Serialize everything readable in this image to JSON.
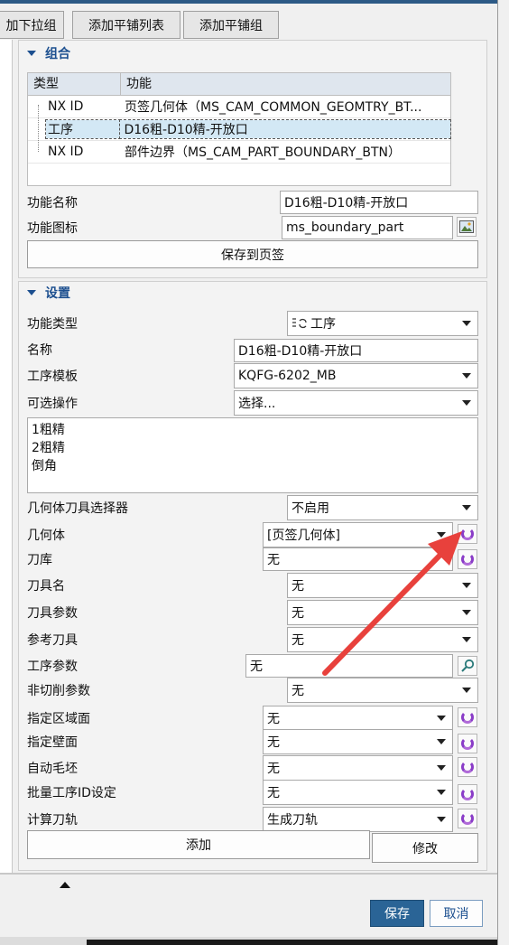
{
  "tabs": [
    "加下拉组",
    "添加平铺列表",
    "添加平铺组"
  ],
  "group_section": {
    "title": "组合",
    "columns": [
      "类型",
      "功能"
    ],
    "rows": [
      {
        "type": "NX ID",
        "function": "页签几何体（MS_CAM_COMMON_GEOMTRY_BT..."
      },
      {
        "type": "工序",
        "function": "D16粗-D10精-开放口"
      },
      {
        "type": "NX ID",
        "function": "部件边界（MS_CAM_PART_BOUNDARY_BTN）"
      }
    ],
    "function_name_label": "功能名称",
    "function_name_value": "D16粗-D10精-开放口",
    "function_icon_label": "功能图标",
    "function_icon_value": "ms_boundary_part",
    "save_button": "保存到页签"
  },
  "settings_section": {
    "title": "设置",
    "fields": {
      "func_type": {
        "label": "功能类型",
        "value": "工序"
      },
      "name": {
        "label": "名称",
        "value": "D16粗-D10精-开放口"
      },
      "template": {
        "label": "工序模板",
        "value": "KQFG-6202_MB"
      },
      "optional_ops": {
        "label": "可选操作",
        "value": "选择..."
      },
      "ops_list": [
        "1粗精",
        "2粗精",
        "倒角"
      ],
      "geom_selector": {
        "label": "几何体刀具选择器",
        "value": "不启用"
      },
      "geometry": {
        "label": "几何体",
        "value": "[页签几何体]"
      },
      "tool_lib": {
        "label": "刀库",
        "value": "无"
      },
      "tool_name": {
        "label": "刀具名",
        "value": "无"
      },
      "tool_params": {
        "label": "刀具参数",
        "value": "无"
      },
      "ref_tool": {
        "label": "参考刀具",
        "value": "无"
      },
      "op_params": {
        "label": "工序参数",
        "value": "无"
      },
      "noncut_params": {
        "label": "非切削参数",
        "value": "无"
      },
      "area": {
        "label": "指定区域面",
        "value": "无"
      },
      "wall": {
        "label": "指定壁面",
        "value": "无"
      },
      "auto_blank": {
        "label": "自动毛坯",
        "value": "无"
      },
      "batch_id": {
        "label": "批量工序ID设定",
        "value": "无"
      },
      "compute_path": {
        "label": "计算刀轨",
        "value": "生成刀轨"
      }
    },
    "add_button": "添加",
    "modify_button": "修改"
  },
  "footer": {
    "save": "保存",
    "cancel": "取消"
  },
  "colors": {
    "accent": "#1c4f8f",
    "primary_button": "#2a6496",
    "arrow": "#e8413c",
    "refresh": "#8a3cc8"
  }
}
